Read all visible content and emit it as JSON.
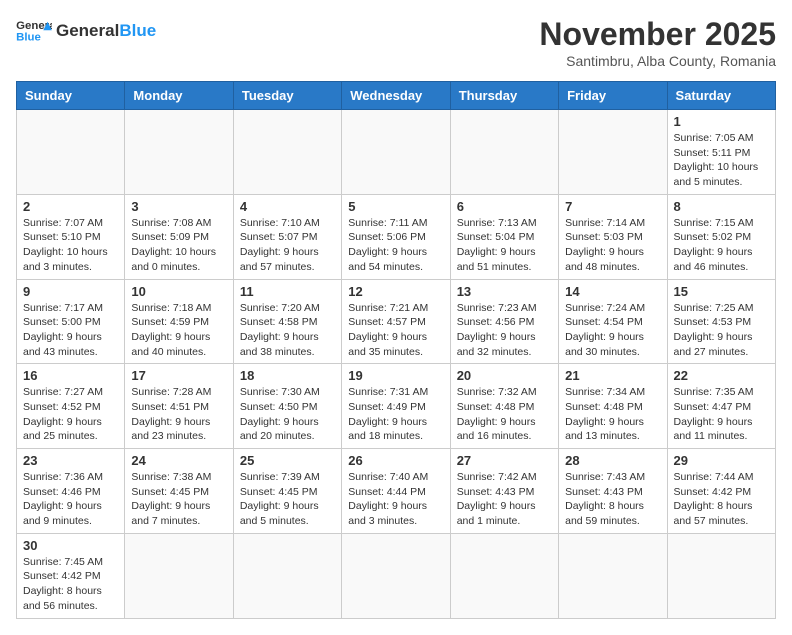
{
  "header": {
    "logo_general": "General",
    "logo_blue": "Blue",
    "month_title": "November 2025",
    "subtitle": "Santimbru, Alba County, Romania"
  },
  "days_of_week": [
    "Sunday",
    "Monday",
    "Tuesday",
    "Wednesday",
    "Thursday",
    "Friday",
    "Saturday"
  ],
  "weeks": [
    [
      {
        "day": "",
        "info": ""
      },
      {
        "day": "",
        "info": ""
      },
      {
        "day": "",
        "info": ""
      },
      {
        "day": "",
        "info": ""
      },
      {
        "day": "",
        "info": ""
      },
      {
        "day": "",
        "info": ""
      },
      {
        "day": "1",
        "info": "Sunrise: 7:05 AM\nSunset: 5:11 PM\nDaylight: 10 hours and 5 minutes."
      }
    ],
    [
      {
        "day": "2",
        "info": "Sunrise: 7:07 AM\nSunset: 5:10 PM\nDaylight: 10 hours and 3 minutes."
      },
      {
        "day": "3",
        "info": "Sunrise: 7:08 AM\nSunset: 5:09 PM\nDaylight: 10 hours and 0 minutes."
      },
      {
        "day": "4",
        "info": "Sunrise: 7:10 AM\nSunset: 5:07 PM\nDaylight: 9 hours and 57 minutes."
      },
      {
        "day": "5",
        "info": "Sunrise: 7:11 AM\nSunset: 5:06 PM\nDaylight: 9 hours and 54 minutes."
      },
      {
        "day": "6",
        "info": "Sunrise: 7:13 AM\nSunset: 5:04 PM\nDaylight: 9 hours and 51 minutes."
      },
      {
        "day": "7",
        "info": "Sunrise: 7:14 AM\nSunset: 5:03 PM\nDaylight: 9 hours and 48 minutes."
      },
      {
        "day": "8",
        "info": "Sunrise: 7:15 AM\nSunset: 5:02 PM\nDaylight: 9 hours and 46 minutes."
      }
    ],
    [
      {
        "day": "9",
        "info": "Sunrise: 7:17 AM\nSunset: 5:00 PM\nDaylight: 9 hours and 43 minutes."
      },
      {
        "day": "10",
        "info": "Sunrise: 7:18 AM\nSunset: 4:59 PM\nDaylight: 9 hours and 40 minutes."
      },
      {
        "day": "11",
        "info": "Sunrise: 7:20 AM\nSunset: 4:58 PM\nDaylight: 9 hours and 38 minutes."
      },
      {
        "day": "12",
        "info": "Sunrise: 7:21 AM\nSunset: 4:57 PM\nDaylight: 9 hours and 35 minutes."
      },
      {
        "day": "13",
        "info": "Sunrise: 7:23 AM\nSunset: 4:56 PM\nDaylight: 9 hours and 32 minutes."
      },
      {
        "day": "14",
        "info": "Sunrise: 7:24 AM\nSunset: 4:54 PM\nDaylight: 9 hours and 30 minutes."
      },
      {
        "day": "15",
        "info": "Sunrise: 7:25 AM\nSunset: 4:53 PM\nDaylight: 9 hours and 27 minutes."
      }
    ],
    [
      {
        "day": "16",
        "info": "Sunrise: 7:27 AM\nSunset: 4:52 PM\nDaylight: 9 hours and 25 minutes."
      },
      {
        "day": "17",
        "info": "Sunrise: 7:28 AM\nSunset: 4:51 PM\nDaylight: 9 hours and 23 minutes."
      },
      {
        "day": "18",
        "info": "Sunrise: 7:30 AM\nSunset: 4:50 PM\nDaylight: 9 hours and 20 minutes."
      },
      {
        "day": "19",
        "info": "Sunrise: 7:31 AM\nSunset: 4:49 PM\nDaylight: 9 hours and 18 minutes."
      },
      {
        "day": "20",
        "info": "Sunrise: 7:32 AM\nSunset: 4:48 PM\nDaylight: 9 hours and 16 minutes."
      },
      {
        "day": "21",
        "info": "Sunrise: 7:34 AM\nSunset: 4:48 PM\nDaylight: 9 hours and 13 minutes."
      },
      {
        "day": "22",
        "info": "Sunrise: 7:35 AM\nSunset: 4:47 PM\nDaylight: 9 hours and 11 minutes."
      }
    ],
    [
      {
        "day": "23",
        "info": "Sunrise: 7:36 AM\nSunset: 4:46 PM\nDaylight: 9 hours and 9 minutes."
      },
      {
        "day": "24",
        "info": "Sunrise: 7:38 AM\nSunset: 4:45 PM\nDaylight: 9 hours and 7 minutes."
      },
      {
        "day": "25",
        "info": "Sunrise: 7:39 AM\nSunset: 4:45 PM\nDaylight: 9 hours and 5 minutes."
      },
      {
        "day": "26",
        "info": "Sunrise: 7:40 AM\nSunset: 4:44 PM\nDaylight: 9 hours and 3 minutes."
      },
      {
        "day": "27",
        "info": "Sunrise: 7:42 AM\nSunset: 4:43 PM\nDaylight: 9 hours and 1 minute."
      },
      {
        "day": "28",
        "info": "Sunrise: 7:43 AM\nSunset: 4:43 PM\nDaylight: 8 hours and 59 minutes."
      },
      {
        "day": "29",
        "info": "Sunrise: 7:44 AM\nSunset: 4:42 PM\nDaylight: 8 hours and 57 minutes."
      }
    ],
    [
      {
        "day": "30",
        "info": "Sunrise: 7:45 AM\nSunset: 4:42 PM\nDaylight: 8 hours and 56 minutes."
      },
      {
        "day": "",
        "info": ""
      },
      {
        "day": "",
        "info": ""
      },
      {
        "day": "",
        "info": ""
      },
      {
        "day": "",
        "info": ""
      },
      {
        "day": "",
        "info": ""
      },
      {
        "day": "",
        "info": ""
      }
    ]
  ]
}
